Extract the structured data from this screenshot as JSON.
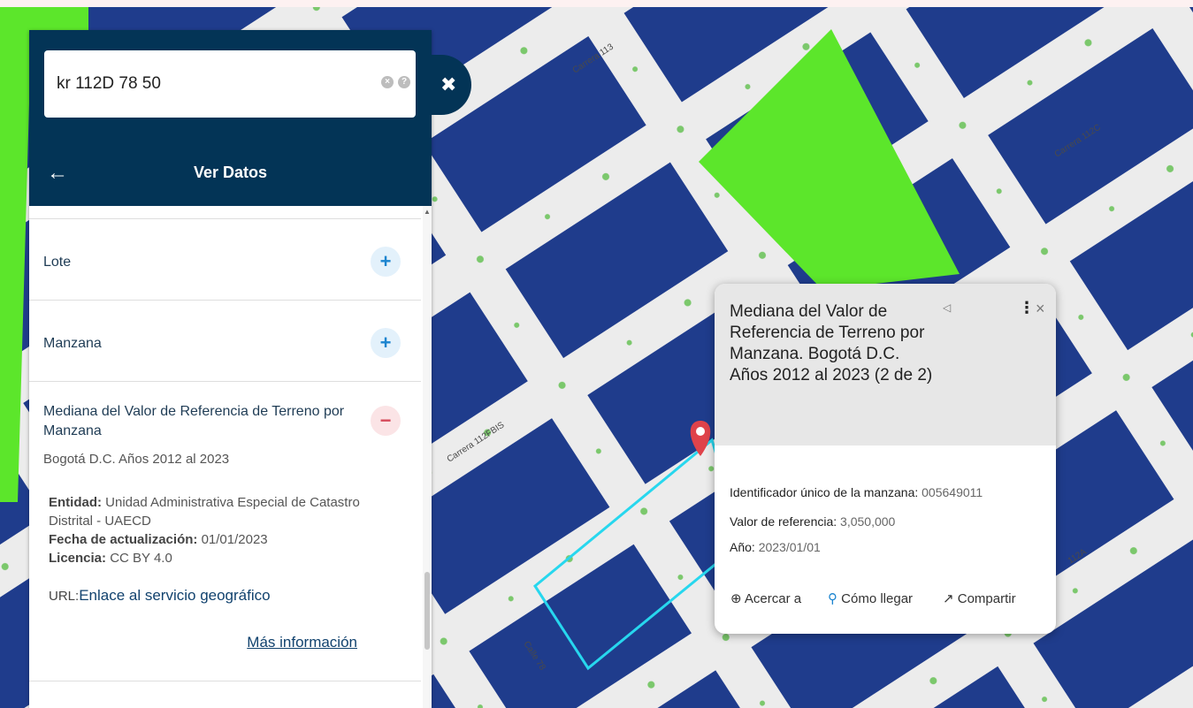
{
  "map": {
    "street_labels": [
      "Carrera 113",
      "Carrera 112C",
      "Carrera 112FBIS",
      "Calle 78",
      "112A"
    ]
  },
  "search": {
    "value": "kr 112D 78 50"
  },
  "header": {
    "title": "Ver Datos"
  },
  "panel": {
    "rows": [
      {
        "label": "Lote"
      },
      {
        "label": "Manzana"
      }
    ],
    "expanded": {
      "title": "Mediana del Valor de Referencia de Terreno por Manzana",
      "subtitle": "Bogotá D.C. Años 2012 al 2023",
      "entidad_key": "Entidad:",
      "entidad_value": "Unidad Administrativa Especial de Catastro Distrital - UAECD",
      "fecha_key": "Fecha de actualización:",
      "fecha_value": "01/01/2023",
      "licencia_key": "Licencia:",
      "licencia_value": "CC BY 4.0",
      "url_key": "URL:",
      "url_link": "Enlace al servicio geográfico",
      "more_info": "Más información"
    }
  },
  "popup": {
    "title": "Mediana del Valor de Referencia de Terreno por Manzana. Bogotá D.C. Años 2012 al 2023 (2 de 2)",
    "fields": [
      {
        "key": "Identificador único de la manzana:",
        "value": "005649011"
      },
      {
        "key": "Valor de referencia:",
        "value": "3,050,000"
      },
      {
        "key": "Año:",
        "value": "2023/01/01"
      }
    ],
    "actions": {
      "zoom": "Acercar a",
      "directions": "Cómo llegar",
      "share": "Compartir"
    }
  },
  "colors": {
    "header": "#033456",
    "block_blue": "#1f3c8c",
    "highlight_green": "#5ce62b",
    "outline_cyan": "#27d7ee"
  }
}
